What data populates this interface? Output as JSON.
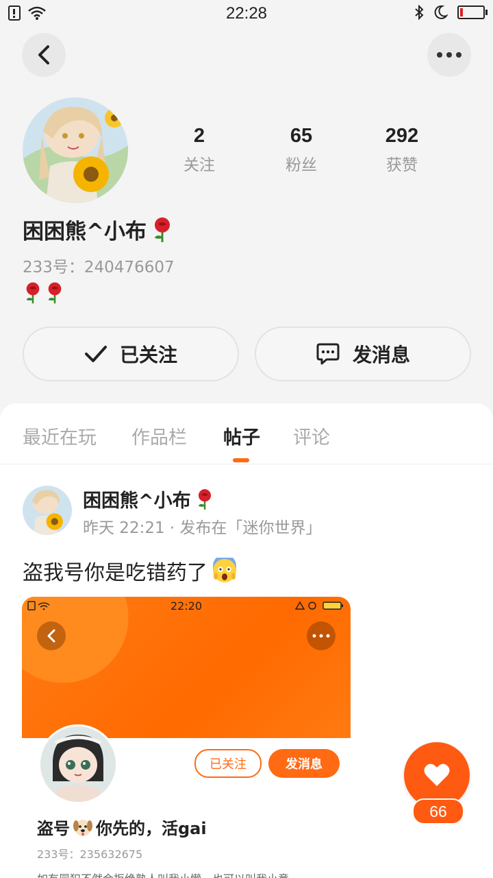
{
  "status_bar": {
    "time": "22:28"
  },
  "profile": {
    "name": "困困熊^小布",
    "id_text": "233号：240476607",
    "stats": [
      {
        "value": "2",
        "label": "关注"
      },
      {
        "value": "65",
        "label": "粉丝"
      },
      {
        "value": "292",
        "label": "获赞"
      }
    ],
    "follow_button": "已关注",
    "message_button": "发消息"
  },
  "tabs": [
    "最近在玩",
    "作品栏",
    "帖子",
    "评论"
  ],
  "active_tab": "帖子",
  "post": {
    "author": "困困熊^小布",
    "meta": "昨天 22:21 · 发布在「迷你世界」",
    "text": "盗我号你是吃错药了",
    "embedded": {
      "time": "22:20",
      "follow_button": "已关注",
      "message_button": "发消息",
      "name_part1": "盗号",
      "name_part2": "你先的，活gai",
      "id_text": "233号：235632675",
      "bio": "如有冒犯不然会拒绝熟人叫我小懒，也可以叫我小意"
    },
    "likes": "66"
  },
  "colors": {
    "accent": "#ff6a13"
  }
}
